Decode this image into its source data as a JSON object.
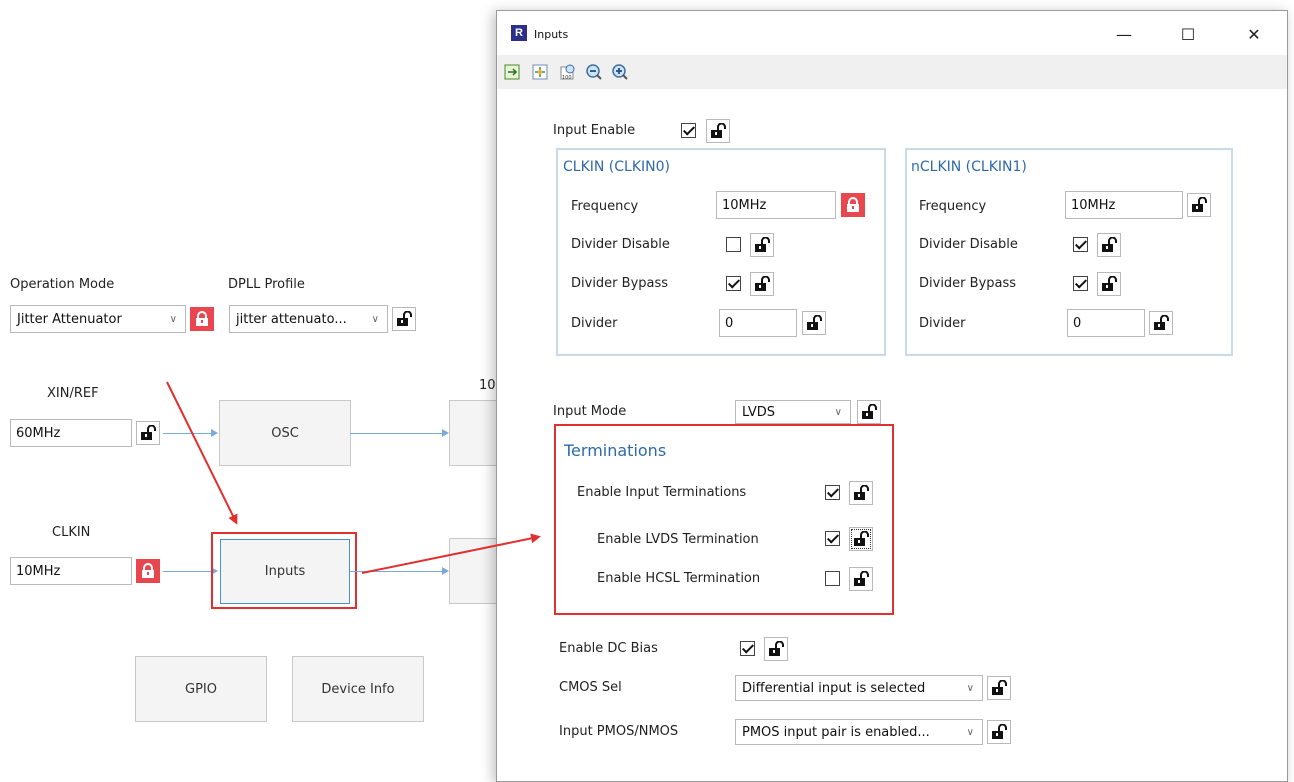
{
  "canvas": {
    "operation_mode": {
      "label": "Operation Mode",
      "value": "Jitter Attenuator"
    },
    "dpll_profile": {
      "label": "DPLL Profile",
      "value": "jitter attenuato..."
    },
    "xin_ref": {
      "label": "XIN/REF",
      "value": "60MHz"
    },
    "clkin": {
      "label": "CLKIN",
      "value": "10MHz"
    },
    "blocks": {
      "osc": "OSC",
      "inputs": "Inputs",
      "gpio": "GPIO",
      "device_info": "Device Info"
    },
    "partial_label": "10"
  },
  "dialog": {
    "title": "Inputs",
    "app_icon_letter": "R",
    "window_buttons": {
      "minimize": "—",
      "maximize": "☐",
      "close": "✕"
    },
    "toolbar_icons": [
      "fit-page-icon",
      "center-icon",
      "zoom-100-icon",
      "zoom-out-icon",
      "zoom-in-icon"
    ],
    "input_enable": {
      "label": "Input Enable",
      "checked": true
    },
    "clkin0": {
      "title": "CLKIN (CLKIN0)",
      "frequency": {
        "label": "Frequency",
        "value": "10MHz",
        "locked": true
      },
      "divider_disable": {
        "label": "Divider Disable",
        "checked": false
      },
      "divider_bypass": {
        "label": "Divider Bypass",
        "checked": true
      },
      "divider": {
        "label": "Divider",
        "value": "0"
      }
    },
    "clkin1": {
      "title": "nCLKIN (CLKIN1)",
      "frequency": {
        "label": "Frequency",
        "value": "10MHz"
      },
      "divider_disable": {
        "label": "Divider Disable",
        "checked": true
      },
      "divider_bypass": {
        "label": "Divider Bypass",
        "checked": true
      },
      "divider": {
        "label": "Divider",
        "value": "0"
      }
    },
    "input_mode": {
      "label": "Input Mode",
      "value": "LVDS"
    },
    "terminations": {
      "title": "Terminations",
      "enable_input": {
        "label": "Enable Input Terminations",
        "checked": true
      },
      "enable_lvds": {
        "label": "Enable LVDS Termination",
        "checked": true
      },
      "enable_hcsl": {
        "label": "Enable HCSL Termination",
        "checked": false
      }
    },
    "dc_bias": {
      "label": "Enable DC Bias",
      "checked": true
    },
    "cmos_sel": {
      "label": "CMOS Sel",
      "value": "Differential input is selected"
    },
    "pmos_nmos": {
      "label": "Input PMOS/NMOS",
      "value": "PMOS input pair is enabled..."
    }
  },
  "colors": {
    "lock_red": "#e8474f",
    "group_title": "#2f6aa8",
    "annotation_red": "#e03030",
    "wire_blue": "#7aa9dc"
  }
}
